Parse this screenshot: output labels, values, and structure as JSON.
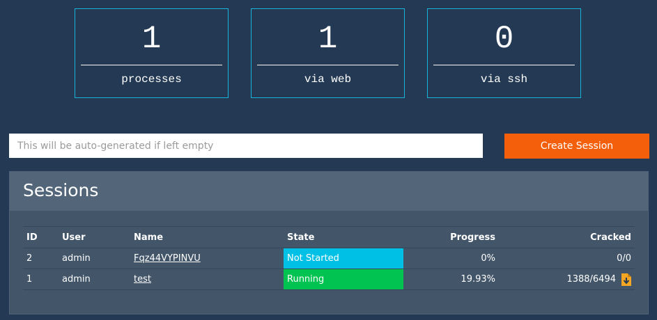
{
  "stats": [
    {
      "value": "1",
      "label": "processes"
    },
    {
      "value": "1",
      "label": "via web"
    },
    {
      "value": "0",
      "label": "via ssh"
    }
  ],
  "session_form": {
    "placeholder": "This will be auto-generated if left empty",
    "value": "",
    "create_label": "Create Session"
  },
  "sessions_panel": {
    "title": "Sessions",
    "columns": [
      "ID",
      "User",
      "Name",
      "State",
      "Progress",
      "Cracked"
    ],
    "rows": [
      {
        "id": "2",
        "user": "admin",
        "name": "Fqz44VYPINVU",
        "state": "Not Started",
        "progress": "0%",
        "cracked": "0/0"
      },
      {
        "id": "1",
        "user": "admin",
        "name": "test",
        "state": "Running",
        "progress": "19.93%",
        "cracked": "1388/6494",
        "download_icon": "file-download-icon"
      }
    ]
  },
  "colors": {
    "background": "#243a54",
    "card_border": "#1ab3d9",
    "accent_button": "#f35f0a",
    "state_not_started": "#00c0e6",
    "state_running": "#00c352",
    "download_icon": "#f5a623"
  }
}
